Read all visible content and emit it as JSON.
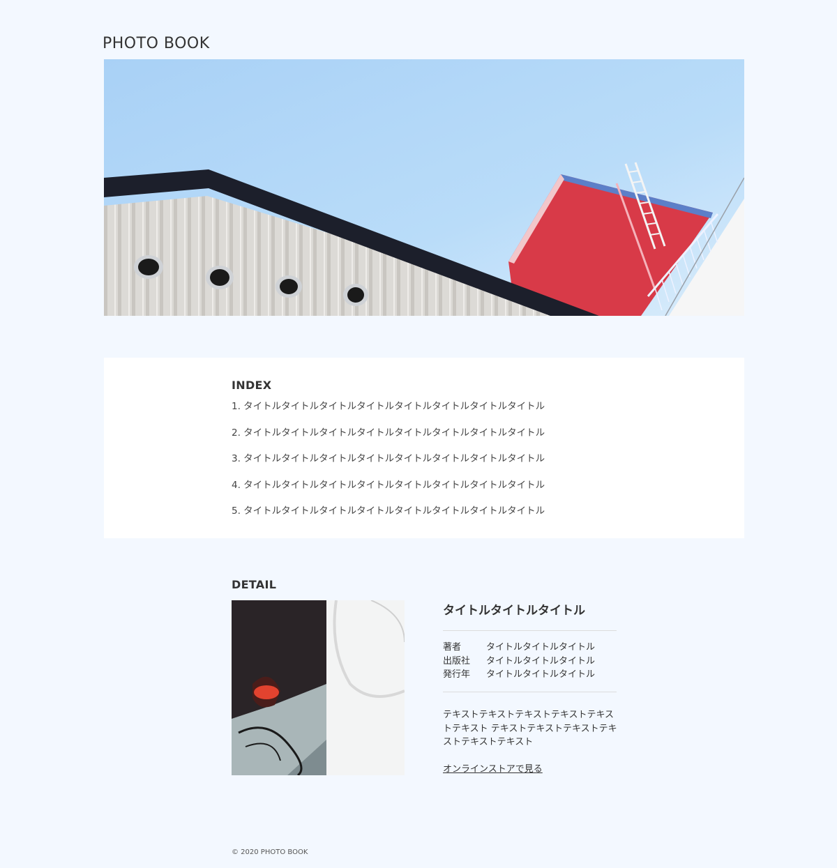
{
  "header": {
    "site_title": "PHOTO BOOK"
  },
  "index": {
    "heading": "INDEX",
    "items": [
      "1. タイトルタイトルタイトルタイトルタイトルタイトルタイトルタイトル",
      "2. タイトルタイトルタイトルタイトルタイトルタイトルタイトルタイトル",
      "3. タイトルタイトルタイトルタイトルタイトルタイトルタイトルタイトル",
      "4. タイトルタイトルタイトルタイトルタイトルタイトルタイトルタイトル",
      "5. タイトルタイトルタイトルタイトルタイトルタイトルタイトルタイトル"
    ]
  },
  "detail": {
    "heading": "DETAIL",
    "book_title": "タイトルタイトルタイトル",
    "meta": [
      {
        "key": "著者",
        "value": "タイトルタイトルタイトル"
      },
      {
        "key": "出版社",
        "value": "タイトルタイトルタイトル"
      },
      {
        "key": "発行年",
        "value": "タイトルタイトルタイトル"
      }
    ],
    "description": "テキストテキストテキストテキストテキストテキスト テキストテキストテキストテキストテキストテキスト",
    "store_link": "オンラインストアで見る"
  },
  "footer": {
    "copyright": "© 2020 PHOTO BOOK"
  },
  "colors": {
    "background": "#f3f8ff",
    "sky": "#aed5f7",
    "red_building": "#d83a48",
    "roof": "#1c1f2b"
  }
}
